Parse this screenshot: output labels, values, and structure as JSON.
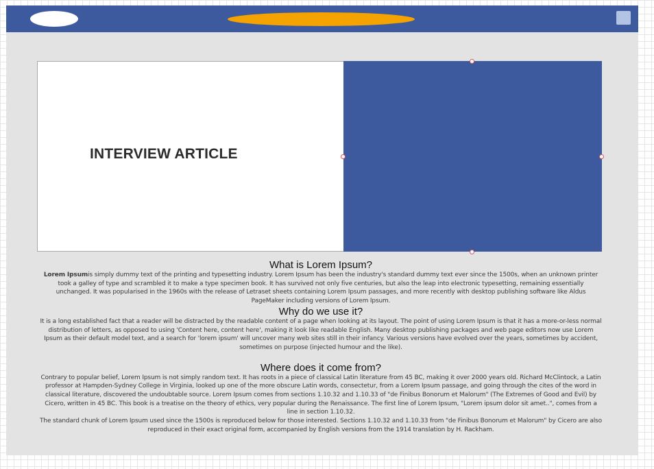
{
  "hero": {
    "title": "INTERVIEW ARTICLE"
  },
  "sections": [
    {
      "heading": "What is Lorem Ipsum?",
      "lead_bold": "Lorem Ipsum",
      "paragraphs": [
        "is simply dummy text of the printing and typesetting industry. Lorem Ipsum has been the industry's standard dummy text ever since the 1500s, when an unknown printer took a galley of type and scrambled it to make a type specimen book. It has survived not only five centuries, but also the leap into electronic typesetting, remaining essentially unchanged. It was popularised in the 1960s with the release of Letraset sheets containing Lorem Ipsum passages, and more recently with desktop publishing software like Aldus PageMaker including versions of Lorem Ipsum."
      ]
    },
    {
      "heading": "Why do we use it?",
      "paragraphs": [
        "It is a long established fact that a reader will be distracted by the readable content of a page when looking at its layout. The point of using Lorem Ipsum is that it has a more-or-less normal distribution of letters, as opposed to using 'Content here, content here', making it look like readable English. Many desktop publishing packages and web page editors now use Lorem Ipsum as their default model text, and a search for 'lorem ipsum' will uncover many web sites still in their infancy. Various versions have evolved over the years, sometimes by accident, sometimes on purpose (injected humour and the like)."
      ]
    },
    {
      "heading": "Where does it come from?",
      "paragraphs": [
        "Contrary to popular belief, Lorem Ipsum is not simply random text. It has roots in a piece of classical Latin literature from 45 BC, making it over 2000 years old. Richard McClintock, a Latin professor at Hampden-Sydney College in Virginia, looked up one of the more obscure Latin words, consectetur, from a Lorem Ipsum passage, and going through the cites of the word in classical literature, discovered the undoubtable source. Lorem Ipsum comes from sections 1.10.32 and 1.10.33 of \"de Finibus Bonorum et Malorum\" (The Extremes of Good and Evil) by Cicero, written in 45 BC. This book is a treatise on the theory of ethics, very popular during the Renaissance. The first line of Lorem Ipsum, \"Lorem ipsum dolor sit amet..\", comes from a line in section 1.10.32.",
        "The standard chunk of Lorem Ipsum used since the 1500s is reproduced below for those interested. Sections 1.10.32 and 1.10.33 from \"de Finibus Bonorum et Malorum\" by Cicero are also reproduced in their exact original form, accompanied by English versions from the 1914 translation by H. Rackham."
      ]
    }
  ],
  "colors": {
    "topbar": "#3d5a9e",
    "banner_accent": "#f5a300",
    "image_placeholder": "#3d5a9e",
    "canvas": "#e3e3e3"
  },
  "icons": {
    "logo": "logo-oval-icon",
    "menu": "menu-square-icon",
    "resize_handle": "resize-handle-icon"
  }
}
